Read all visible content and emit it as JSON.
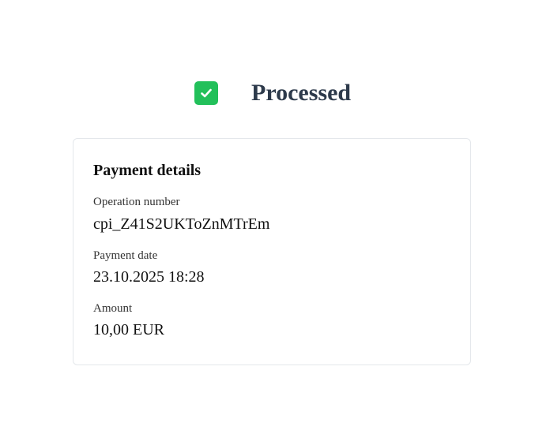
{
  "status": {
    "icon": "check-icon",
    "badge_color": "#22c05a",
    "title": "Processed"
  },
  "payment_details": {
    "title": "Payment details",
    "operation_number": {
      "label": "Operation number",
      "value": "cpi_Z41S2UKToZnMTrEm"
    },
    "payment_date": {
      "label": "Payment date",
      "value": "23.10.2025 18:28"
    },
    "amount": {
      "label": "Amount",
      "value": "10,00 EUR"
    }
  }
}
